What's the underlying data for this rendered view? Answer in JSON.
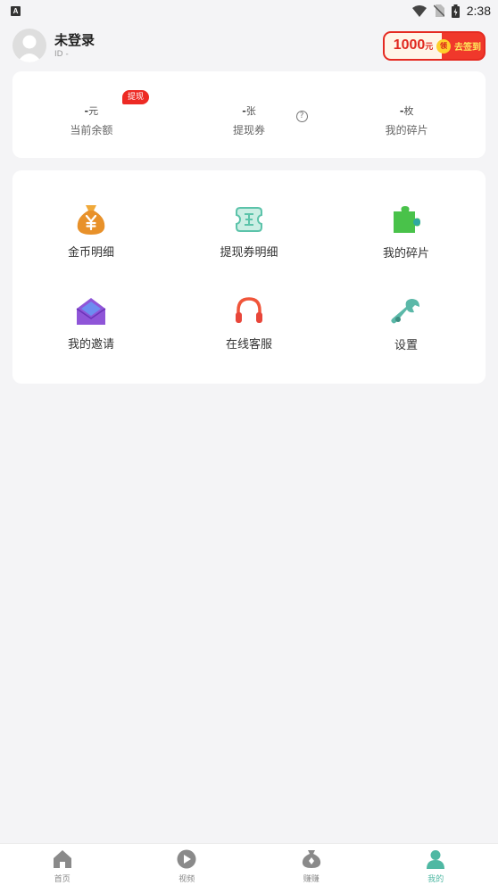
{
  "status_bar": {
    "time": "2:38",
    "left_icon": "a-box-icon",
    "left_glyph": "A",
    "icons": [
      "wifi-icon",
      "no-sim-icon",
      "battery-icon"
    ]
  },
  "header": {
    "user_name": "未登录",
    "user_id": "ID  -",
    "signin": {
      "amount": "1000",
      "unit": "元",
      "badge": "领",
      "cta": "去签到"
    }
  },
  "balance": {
    "items": [
      {
        "value": "-",
        "unit": "元",
        "label": "当前余额"
      },
      {
        "value": "-",
        "unit": "张",
        "label": "提现券"
      },
      {
        "value": "-",
        "unit": "枚",
        "label": "我的碎片"
      }
    ],
    "withdraw_badge": "提现",
    "help_glyph": "?"
  },
  "menu": {
    "items": [
      {
        "label": "金币明细",
        "icon": "money-bag-icon"
      },
      {
        "label": "提现券明细",
        "icon": "ticket-icon"
      },
      {
        "label": "我的碎片",
        "icon": "puzzle-icon"
      },
      {
        "label": "我的邀请",
        "icon": "envelope-icon"
      },
      {
        "label": "在线客服",
        "icon": "headset-icon"
      },
      {
        "label": "设置",
        "icon": "wrench-icon"
      }
    ]
  },
  "tabbar": {
    "tabs": [
      {
        "label": "首页",
        "icon": "home-icon",
        "active": false
      },
      {
        "label": "视频",
        "icon": "play-icon",
        "active": false
      },
      {
        "label": "赚赚",
        "icon": "money-pouch-icon",
        "active": false
      },
      {
        "label": "我的",
        "icon": "person-icon",
        "active": true
      }
    ]
  },
  "colors": {
    "accent": "#4fb8a3",
    "red": "#ed2a24",
    "background": "#f4f4f6"
  }
}
